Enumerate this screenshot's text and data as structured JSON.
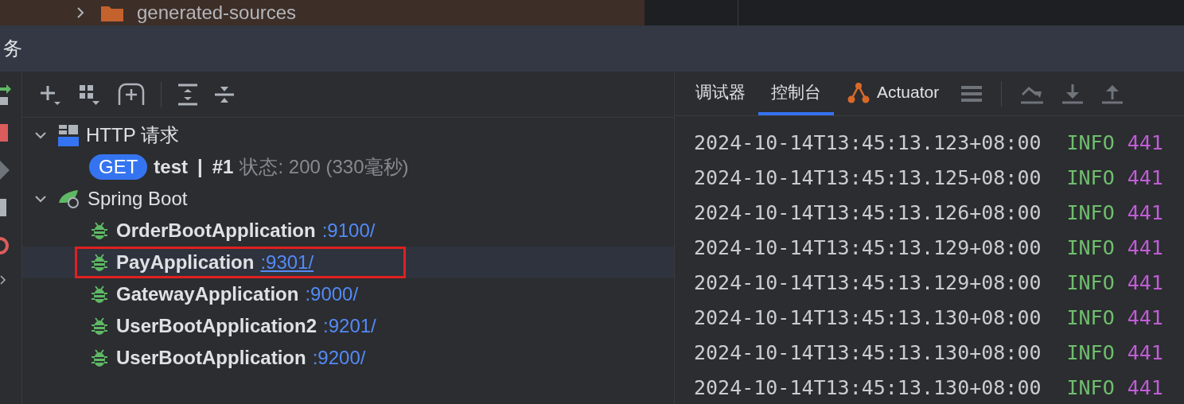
{
  "project_tree": {
    "item": "generated-sources",
    "expanded": false
  },
  "tool_window": {
    "title": "务"
  },
  "tree": [
    {
      "kind": "http",
      "label": "HTTP 请求",
      "expanded": true,
      "children": [
        {
          "method": "GET",
          "name": "test",
          "separator": "|",
          "run": "#1",
          "status": "状态: 200 (330毫秒)"
        }
      ]
    },
    {
      "kind": "spring",
      "label": "Spring Boot",
      "expanded": true,
      "children": [
        {
          "name": "OrderBootApplication",
          "port": ":9100/",
          "selected": false,
          "underlined": false,
          "annotated": false
        },
        {
          "name": "PayApplication",
          "port": ":9301/",
          "selected": true,
          "underlined": true,
          "annotated": true
        },
        {
          "name": "GatewayApplication",
          "port": ":9000/",
          "selected": false,
          "underlined": false,
          "annotated": false
        },
        {
          "name": "UserBootApplication2",
          "port": ":9201/",
          "selected": false,
          "underlined": false,
          "annotated": false
        },
        {
          "name": "UserBootApplication",
          "port": ":9200/",
          "selected": false,
          "underlined": false,
          "annotated": false
        }
      ]
    }
  ],
  "tabs": [
    {
      "label": "调试器",
      "kind": "text",
      "selected": false
    },
    {
      "label": "控制台",
      "kind": "text",
      "selected": true
    },
    {
      "label": "Actuator",
      "kind": "actuator",
      "selected": false
    }
  ],
  "log": [
    {
      "time": "2024-10-14T13:45:13.123+08:00",
      "level": "INFO",
      "pid": "441"
    },
    {
      "time": "2024-10-14T13:45:13.125+08:00",
      "level": "INFO",
      "pid": "441"
    },
    {
      "time": "2024-10-14T13:45:13.126+08:00",
      "level": "INFO",
      "pid": "441"
    },
    {
      "time": "2024-10-14T13:45:13.129+08:00",
      "level": "INFO",
      "pid": "441"
    },
    {
      "time": "2024-10-14T13:45:13.129+08:00",
      "level": "INFO",
      "pid": "441"
    },
    {
      "time": "2024-10-14T13:45:13.130+08:00",
      "level": "INFO",
      "pid": "441"
    },
    {
      "time": "2024-10-14T13:45:13.130+08:00",
      "level": "INFO",
      "pid": "441"
    },
    {
      "time": "2024-10-14T13:45:13.130+08:00",
      "level": "INFO",
      "pid": "441"
    }
  ]
}
